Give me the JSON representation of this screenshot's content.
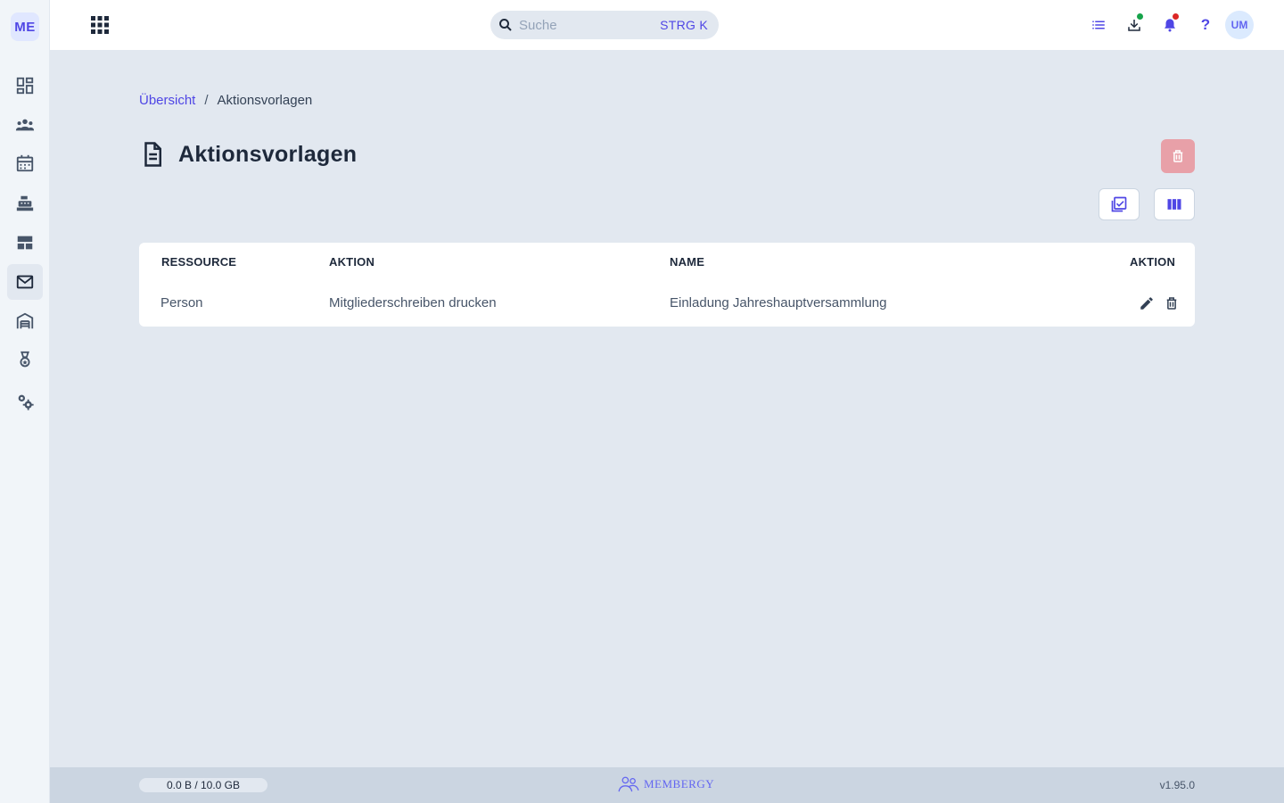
{
  "app": {
    "logo_text": "ME",
    "colors": {
      "accent": "#4f46e5",
      "danger_disabled": "#e8a0a8",
      "background": "#e2e8f0"
    }
  },
  "sidebar": {
    "items": [
      {
        "icon": "dashboard-icon",
        "active": false
      },
      {
        "icon": "people-icon",
        "active": false
      },
      {
        "icon": "calendar-icon",
        "active": false
      },
      {
        "icon": "cash-register-icon",
        "active": false
      },
      {
        "icon": "table-layout-icon",
        "active": false
      },
      {
        "icon": "mail-icon",
        "active": true
      },
      {
        "icon": "warehouse-icon",
        "active": false
      },
      {
        "icon": "award-icon",
        "active": false
      },
      {
        "icon": "settings-icon",
        "active": false
      }
    ]
  },
  "topbar": {
    "search_placeholder": "Suche",
    "search_value": "",
    "search_shortcut": "STRG K",
    "icons": [
      "task-list-icon",
      "download-icon",
      "bell-icon",
      "help-icon"
    ],
    "help_glyph": "?",
    "avatar_initials": "UM"
  },
  "breadcrumb": {
    "link": "Übersicht",
    "separator": "/",
    "current": "Aktionsvorlagen"
  },
  "page": {
    "title": "Aktionsvorlagen"
  },
  "table": {
    "columns": [
      "RESSOURCE",
      "AKTION",
      "NAME",
      "AKTION"
    ],
    "rows": [
      {
        "ressource": "Person",
        "aktion": "Mitgliederschreiben drucken",
        "name": "Einladung Jahreshauptversammlung"
      }
    ]
  },
  "footer": {
    "storage": "0.0 B / 10.0 GB",
    "brand": "MEMBERGY",
    "version": "v1.95.0"
  }
}
